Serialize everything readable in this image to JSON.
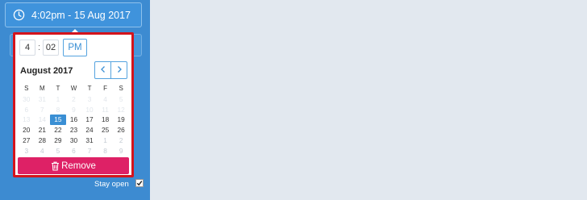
{
  "trigger": {
    "label": "4:02pm - 15 Aug 2017",
    "icon": "clock-icon"
  },
  "time": {
    "hour": "4",
    "separator": ":",
    "minute": "02",
    "ampm": "PM"
  },
  "calendar": {
    "month_title": "August 2017",
    "prev_icon": "chevron-left-icon",
    "next_icon": "chevron-right-icon",
    "weekdays": [
      "S",
      "M",
      "T",
      "W",
      "T",
      "F",
      "S"
    ],
    "weeks": [
      [
        "30",
        "31",
        "1",
        "2",
        "3",
        "4",
        "5"
      ],
      [
        "6",
        "7",
        "8",
        "9",
        "10",
        "11",
        "12"
      ],
      [
        "13",
        "14",
        "15",
        "16",
        "17",
        "18",
        "19"
      ],
      [
        "20",
        "21",
        "22",
        "23",
        "24",
        "25",
        "26"
      ],
      [
        "27",
        "28",
        "29",
        "30",
        "31",
        "1",
        "2"
      ],
      [
        "3",
        "4",
        "5",
        "6",
        "7",
        "8",
        "9"
      ]
    ],
    "selected_day": "15"
  },
  "remove": {
    "label": "Remove",
    "icon": "trash-icon"
  },
  "stay_open": {
    "label": "Stay open",
    "checked": true
  },
  "colors": {
    "sidebar": "#3d8bd1",
    "accent": "#3a8fd4",
    "remove": "#de2166",
    "highlight": "#d4141c"
  }
}
